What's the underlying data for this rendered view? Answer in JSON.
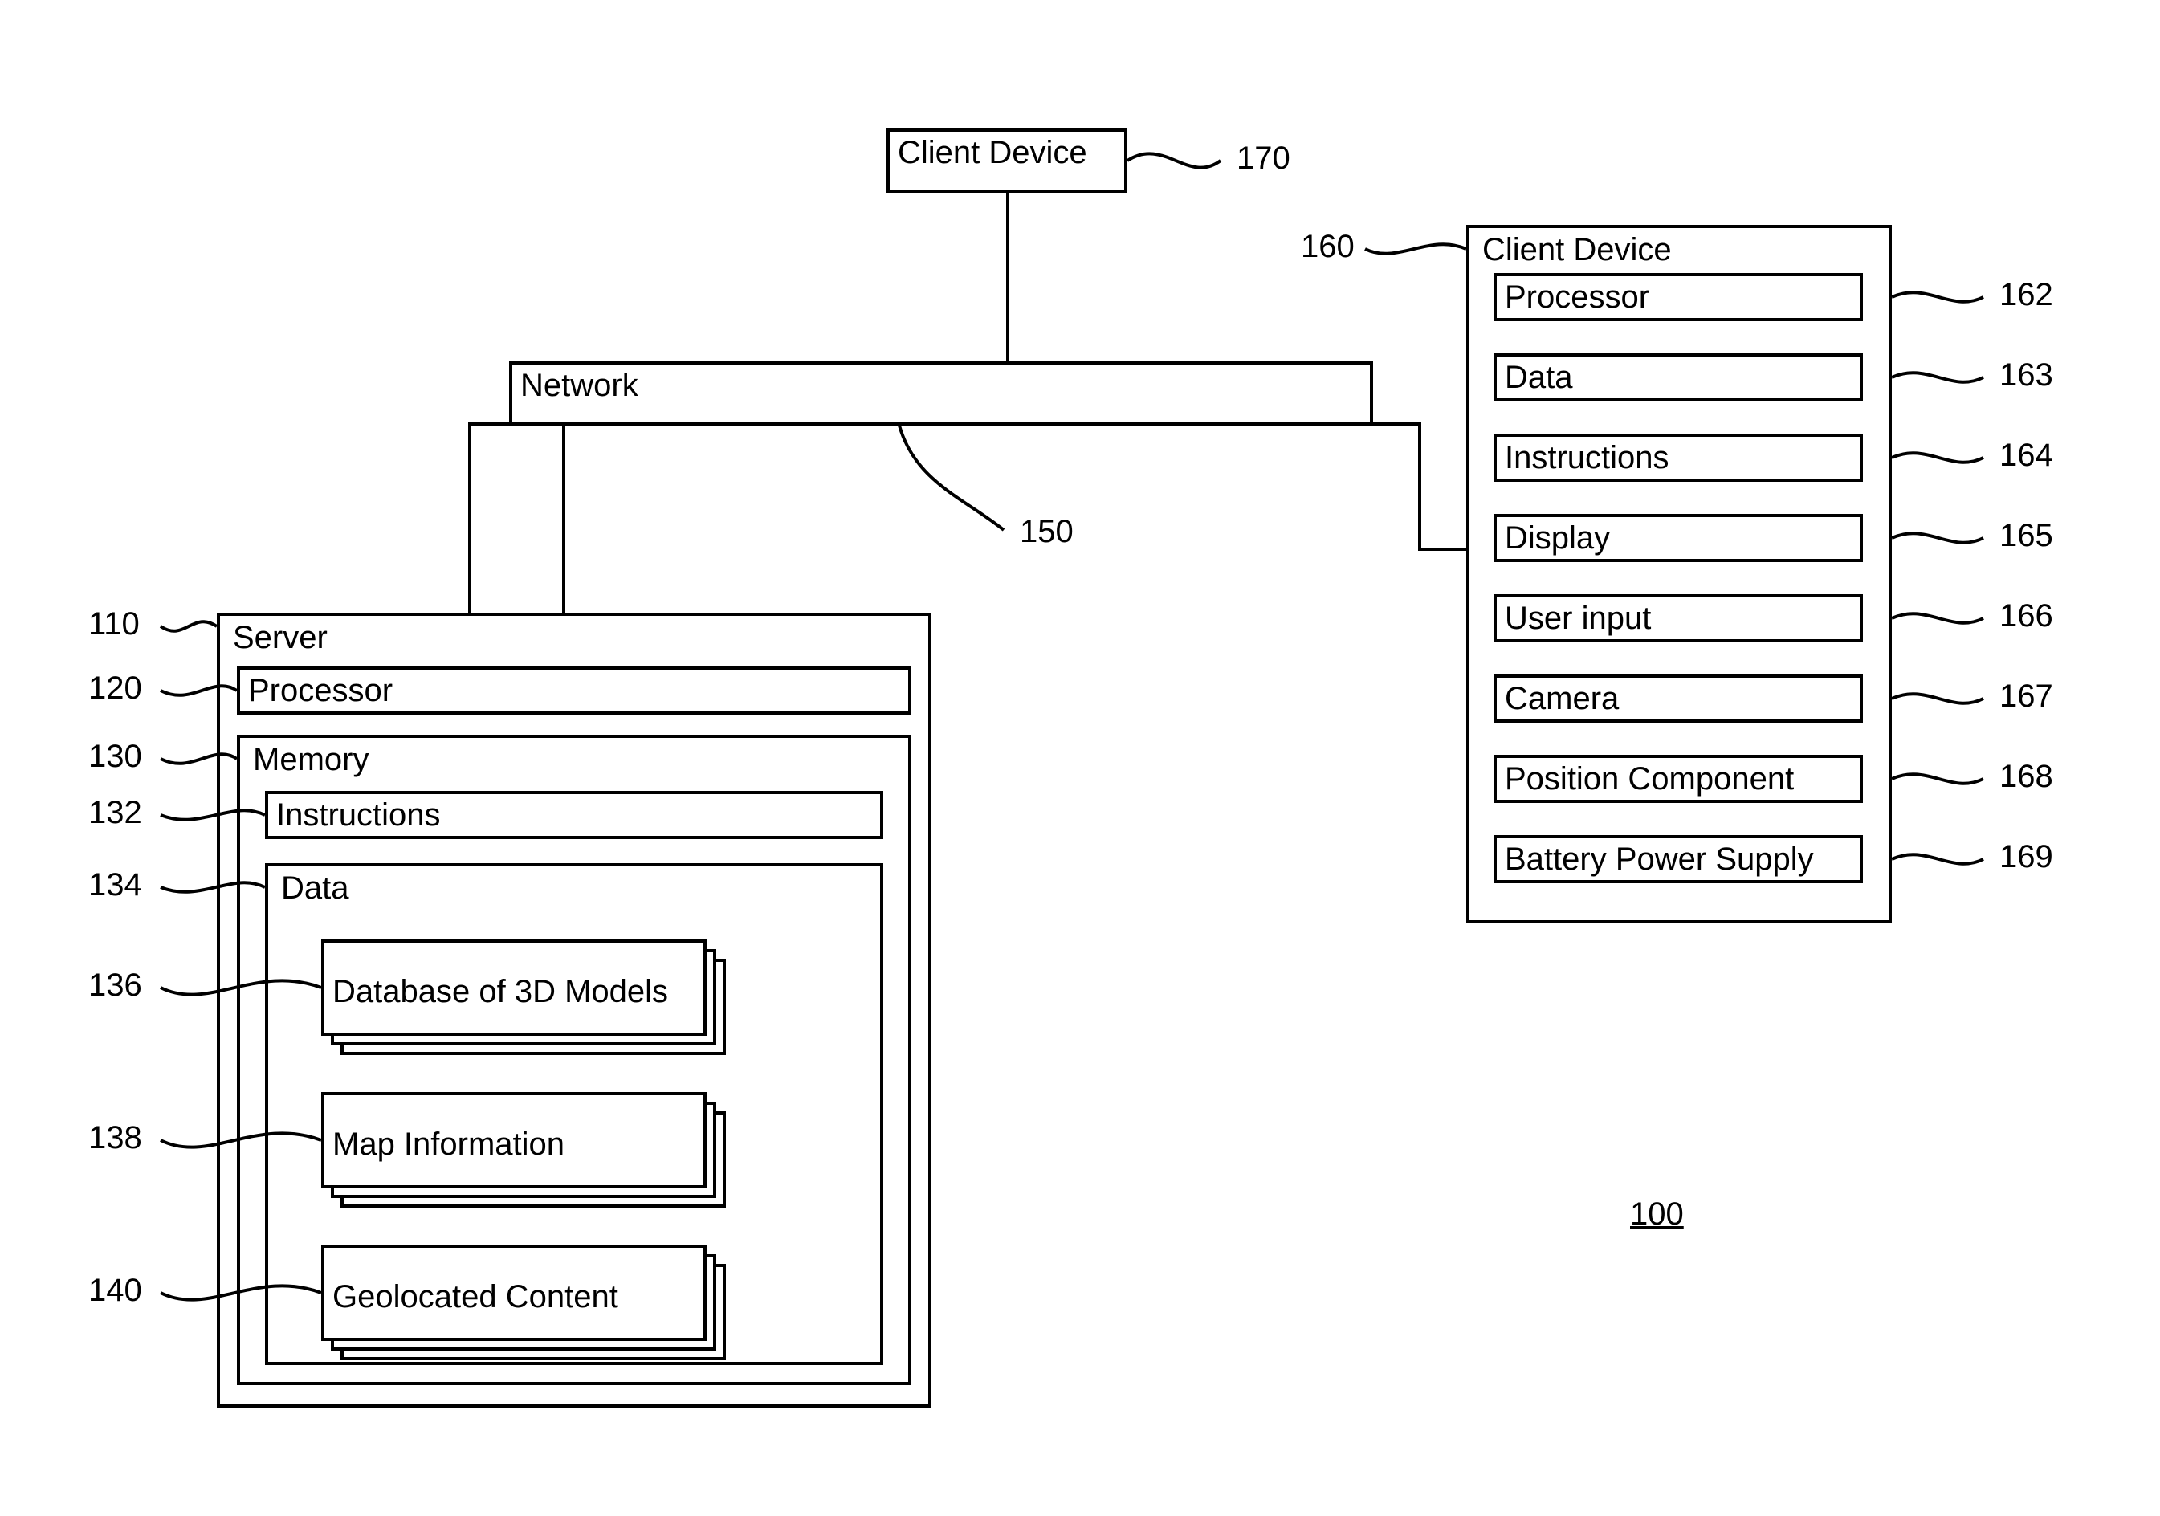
{
  "figure_ref": "100",
  "client_device_top": {
    "label": "Client Device",
    "ref": "170"
  },
  "network": {
    "label": "Network",
    "ref": "150"
  },
  "server": {
    "label": "Server",
    "ref": "110",
    "processor": {
      "label": "Processor",
      "ref": "120"
    },
    "memory": {
      "label": "Memory",
      "ref": "130",
      "instructions": {
        "label": "Instructions",
        "ref": "132"
      },
      "data": {
        "label": "Data",
        "ref": "134",
        "db3d": {
          "label": "Database of 3D Models",
          "ref": "136"
        },
        "mapinfo": {
          "label": "Map Information",
          "ref": "138"
        },
        "geocontent": {
          "label": "Geolocated Content",
          "ref": "140"
        }
      }
    }
  },
  "client_device_right": {
    "label": "Client Device",
    "ref": "160",
    "items": [
      {
        "label": "Processor",
        "ref": "162"
      },
      {
        "label": "Data",
        "ref": "163"
      },
      {
        "label": "Instructions",
        "ref": "164"
      },
      {
        "label": "Display",
        "ref": "165"
      },
      {
        "label": "User input",
        "ref": "166"
      },
      {
        "label": "Camera",
        "ref": "167"
      },
      {
        "label": "Position Component",
        "ref": "168"
      },
      {
        "label": "Battery Power Supply",
        "ref": "169"
      }
    ]
  }
}
